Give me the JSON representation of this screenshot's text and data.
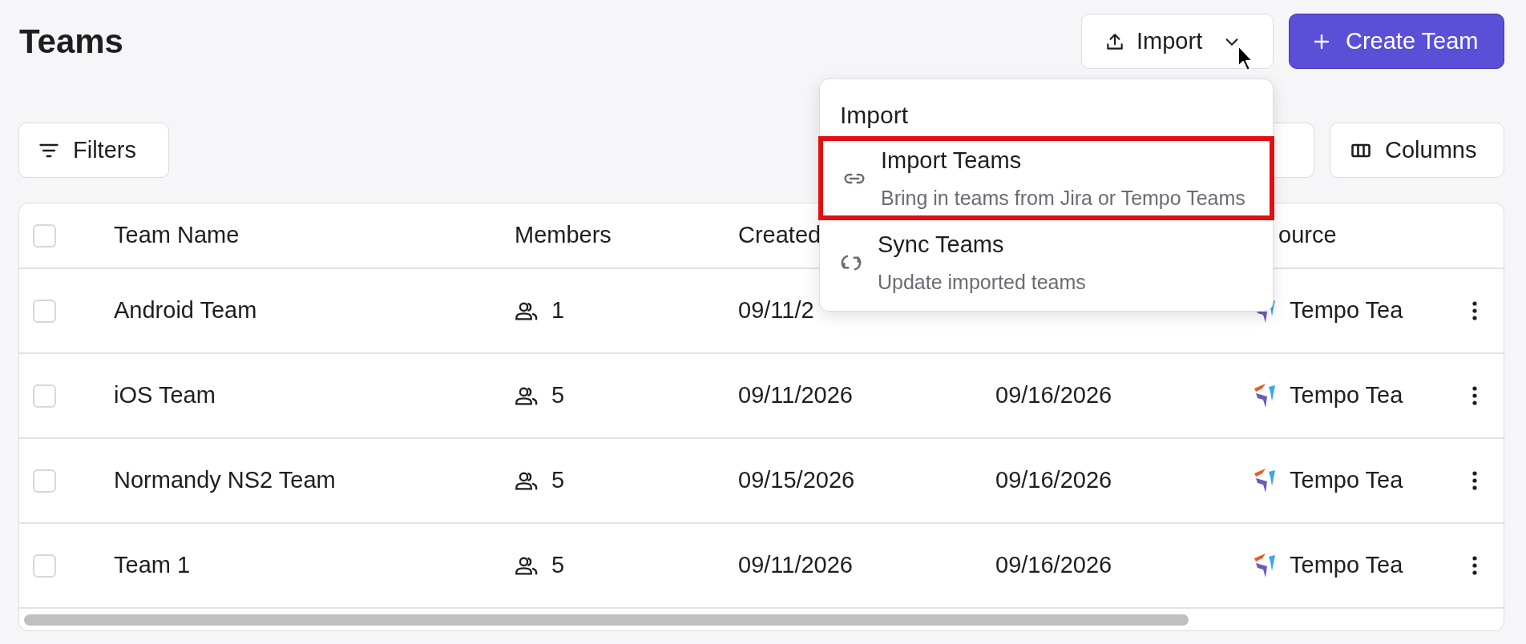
{
  "page": {
    "title": "Teams"
  },
  "actions": {
    "import_button": "Import",
    "create_button": "Create Team"
  },
  "toolbar": {
    "filters_button": "Filters",
    "columns_button": "Columns"
  },
  "import_menu": {
    "title": "Import",
    "items": [
      {
        "kind": "link",
        "label": "Import Teams",
        "description": "Bring in teams from Jira or Tempo Teams",
        "highlighted": true
      },
      {
        "kind": "sync",
        "label": "Sync Teams",
        "description": "Update imported teams",
        "highlighted": false
      }
    ]
  },
  "table": {
    "select_all_checked": false,
    "columns": [
      "Team Name",
      "Members",
      "Created",
      "ource"
    ],
    "rows": [
      {
        "checked": false,
        "name": "Android Team",
        "members": "1",
        "created": "09/11/2",
        "source": "Tempo Tea"
      },
      {
        "checked": false,
        "name": "iOS Team",
        "members": "5",
        "created": "09/11/2026",
        "updated": "09/16/2026",
        "source": "Tempo Tea"
      },
      {
        "checked": false,
        "name": "Normandy NS2 Team",
        "members": "5",
        "created": "09/15/2026",
        "updated": "09/16/2026",
        "source": "Tempo Tea"
      },
      {
        "checked": false,
        "name": "Team 1",
        "members": "5",
        "created": "09/11/2026",
        "updated": "09/16/2026",
        "source": "Tempo Tea"
      }
    ]
  }
}
